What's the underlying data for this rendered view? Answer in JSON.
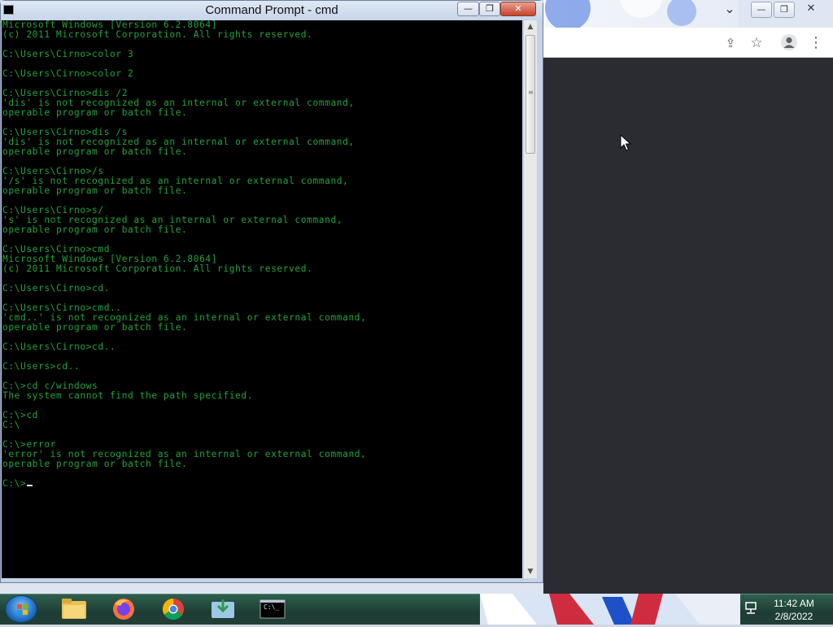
{
  "cmd": {
    "title": "Command Prompt - cmd",
    "controls": {
      "minimize": "—",
      "maximize": "❐",
      "close": "✕"
    },
    "text_color": "#23a33a",
    "lines": [
      "Microsoft Windows [Version 6.2.8064]",
      "(c) 2011 Microsoft Corporation. All rights reserved.",
      "",
      "C:\\Users\\Cirno>color 3",
      "",
      "C:\\Users\\Cirno>color 2",
      "",
      "C:\\Users\\Cirno>dis /2",
      "'dis' is not recognized as an internal or external command,",
      "operable program or batch file.",
      "",
      "C:\\Users\\Cirno>dis /s",
      "'dis' is not recognized as an internal or external command,",
      "operable program or batch file.",
      "",
      "C:\\Users\\Cirno>/s",
      "'/s' is not recognized as an internal or external command,",
      "operable program or batch file.",
      "",
      "C:\\Users\\Cirno>s/",
      "'s' is not recognized as an internal or external command,",
      "operable program or batch file.",
      "",
      "C:\\Users\\Cirno>cmd",
      "Microsoft Windows [Version 6.2.8064]",
      "(c) 2011 Microsoft Corporation. All rights reserved.",
      "",
      "C:\\Users\\Cirno>cd.",
      "",
      "C:\\Users\\Cirno>cmd..",
      "'cmd..' is not recognized as an internal or external command,",
      "operable program or batch file.",
      "",
      "C:\\Users\\Cirno>cd..",
      "",
      "C:\\Users>cd..",
      "",
      "C:\\>cd c/windows",
      "The system cannot find the path specified.",
      "",
      "C:\\>cd",
      "C:\\",
      "",
      "C:\\>error",
      "'error' is not recognized as an internal or external command,",
      "operable program or batch file.",
      ""
    ],
    "prompt": "C:\\>",
    "scrollbar": {
      "up_arrow": "▲",
      "down_arrow": "▼",
      "thumb_position_fraction": 0.0,
      "thumb_size_fraction": 0.22
    }
  },
  "browser": {
    "controls": {
      "tab_list": "⌄",
      "minimize": "—",
      "maximize": "❐",
      "close": "✕"
    },
    "toolbar_icons": [
      "share-icon",
      "star-icon",
      "profile-icon",
      "menu-icon"
    ],
    "share_glyph": "⇪",
    "star_glyph": "☆",
    "menu_glyph": "⋮",
    "content_color": "#2a2c32"
  },
  "taskbar": {
    "apps": [
      {
        "name": "file-explorer",
        "active": false
      },
      {
        "name": "firefox",
        "active": false
      },
      {
        "name": "chrome",
        "active": true
      },
      {
        "name": "downloader",
        "active": true
      },
      {
        "name": "command-prompt",
        "active": true
      }
    ],
    "cmd_icon_text": "C:\\_",
    "clock": {
      "time": "11:42 AM",
      "date": "2/8/2022"
    }
  }
}
